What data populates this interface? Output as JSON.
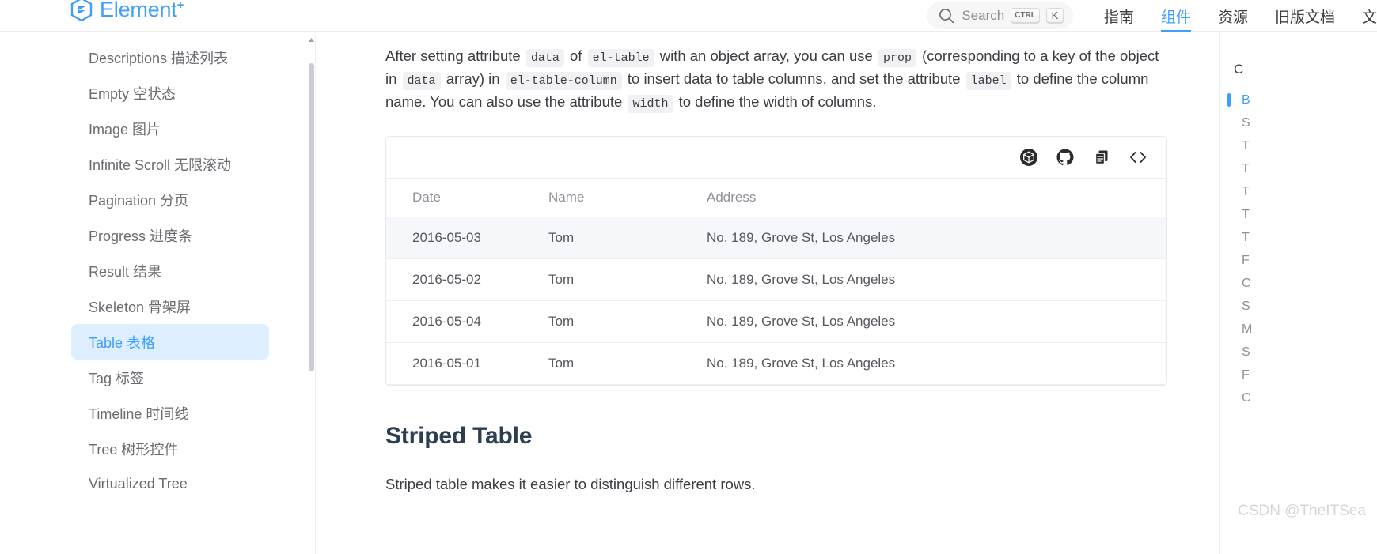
{
  "header": {
    "brand_name": "Element",
    "brand_superscript": "+",
    "search": {
      "placeholder": "Search",
      "kbd_ctrl": "CTRL",
      "kbd_key": "K"
    },
    "nav": [
      {
        "label": "指南",
        "active": false
      },
      {
        "label": "组件",
        "active": true
      },
      {
        "label": "资源",
        "active": false
      },
      {
        "label": "旧版文档",
        "active": false
      },
      {
        "label": "文",
        "active": false
      }
    ]
  },
  "sidebar": {
    "items": [
      {
        "label": "Descriptions 描述列表",
        "active": false
      },
      {
        "label": "Empty 空状态",
        "active": false
      },
      {
        "label": "Image 图片",
        "active": false
      },
      {
        "label": "Infinite Scroll 无限滚动",
        "active": false
      },
      {
        "label": "Pagination 分页",
        "active": false
      },
      {
        "label": "Progress 进度条",
        "active": false
      },
      {
        "label": "Result 结果",
        "active": false
      },
      {
        "label": "Skeleton 骨架屏",
        "active": false
      },
      {
        "label": "Table 表格",
        "active": true
      },
      {
        "label": "Tag 标签",
        "active": false
      },
      {
        "label": "Timeline 时间线",
        "active": false
      },
      {
        "label": "Tree 树形控件",
        "active": false
      },
      {
        "label": "Virtualized Tree",
        "active": false
      }
    ]
  },
  "main": {
    "intro": {
      "t1": "After setting attribute ",
      "c1": "data",
      "t2": " of ",
      "c2": "el-table",
      "t3": " with an object array, you can use ",
      "c3": "prop",
      "t4": " (corresponding to a key of the object in ",
      "c4": "data",
      "t5": " array) in ",
      "c5": "el-table-column",
      "t6": " to insert data to table columns, and set the attribute ",
      "c6": "label",
      "t7": " to define the column name. You can also use the attribute ",
      "c7": "width",
      "t8": " to define the width of columns."
    },
    "demo_actions": [
      {
        "name": "codesandbox-icon",
        "title": "CodeSandbox"
      },
      {
        "name": "github-icon",
        "title": "GitHub"
      },
      {
        "name": "copy-icon",
        "title": "Copy"
      },
      {
        "name": "code-icon",
        "title": "Source"
      }
    ],
    "table": {
      "columns": [
        "Date",
        "Name",
        "Address"
      ],
      "rows": [
        {
          "date": "2016-05-03",
          "name": "Tom",
          "address": "No. 189, Grove St, Los Angeles",
          "hovered": true
        },
        {
          "date": "2016-05-02",
          "name": "Tom",
          "address": "No. 189, Grove St, Los Angeles",
          "hovered": false
        },
        {
          "date": "2016-05-04",
          "name": "Tom",
          "address": "No. 189, Grove St, Los Angeles",
          "hovered": false
        },
        {
          "date": "2016-05-01",
          "name": "Tom",
          "address": "No. 189, Grove St, Los Angeles",
          "hovered": false
        }
      ]
    },
    "striped_heading": "Striped Table",
    "striped_paragraph": "Striped table makes it easier to distinguish different rows."
  },
  "toc": {
    "title": "C",
    "items": [
      {
        "label": "B",
        "active": true
      },
      {
        "label": "S",
        "active": false
      },
      {
        "label": "T",
        "active": false
      },
      {
        "label": "T",
        "active": false
      },
      {
        "label": "T",
        "active": false
      },
      {
        "label": "T",
        "active": false
      },
      {
        "label": "T",
        "active": false
      },
      {
        "label": "F",
        "active": false
      },
      {
        "label": "C",
        "active": false
      },
      {
        "label": "S",
        "active": false
      },
      {
        "label": "M",
        "active": false
      },
      {
        "label": "S",
        "active": false
      },
      {
        "label": "F",
        "active": false
      },
      {
        "label": "C",
        "active": false
      }
    ]
  },
  "watermark": "CSDN @TheITSea"
}
